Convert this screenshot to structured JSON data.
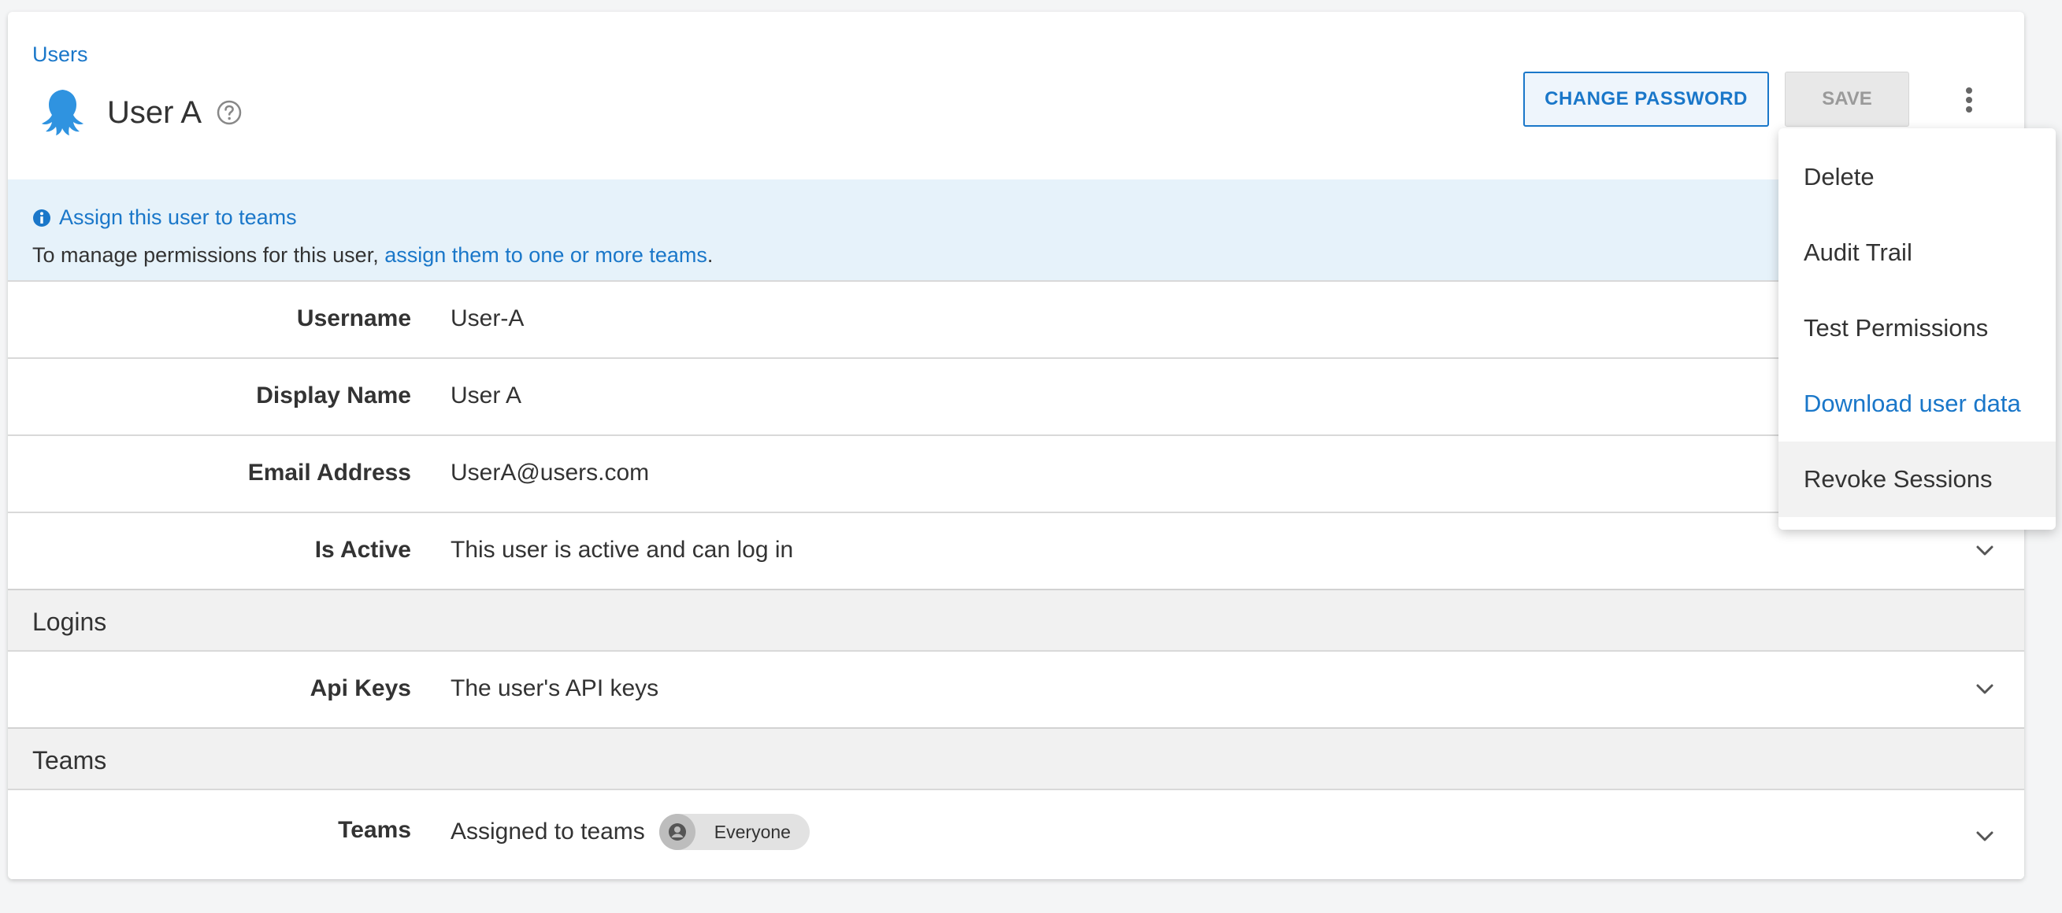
{
  "breadcrumb": {
    "label": "Users"
  },
  "header": {
    "title": "User A",
    "change_password_label": "CHANGE PASSWORD",
    "save_label": "SAVE"
  },
  "info_banner": {
    "title": "Assign this user to teams",
    "text_prefix": "To manage permissions for this user, ",
    "link_text": "assign them to one or more teams",
    "text_suffix": "."
  },
  "fields": [
    {
      "label": "Username",
      "value": "User-A"
    },
    {
      "label": "Display Name",
      "value": "User A"
    },
    {
      "label": "Email Address",
      "value": "UserA@users.com"
    },
    {
      "label": "Is Active",
      "value": "This user is active and can log in"
    }
  ],
  "logins_section": {
    "title": "Logins",
    "api_keys": {
      "label": "Api Keys",
      "value": "The user's API keys"
    }
  },
  "teams_section": {
    "title": "Teams",
    "teams": {
      "label": "Teams",
      "value": "Assigned to teams",
      "chip": "Everyone"
    }
  },
  "menu": {
    "items": [
      {
        "label": "Delete"
      },
      {
        "label": "Audit Trail"
      },
      {
        "label": "Test Permissions"
      },
      {
        "label": "Download user data"
      },
      {
        "label": "Revoke Sessions"
      }
    ]
  },
  "colors": {
    "accent": "#1a77c9",
    "banner_bg": "#e6f2fa",
    "section_bg": "#f1f1f1",
    "logo": "#2f93e0"
  }
}
